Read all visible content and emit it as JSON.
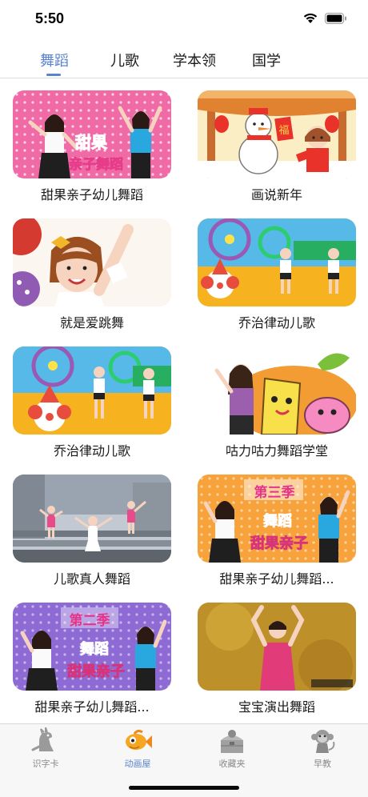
{
  "status_bar": {
    "time": "5:50",
    "icons": [
      "wifi-icon",
      "battery-icon"
    ]
  },
  "top_tabs": {
    "active_index": 0,
    "accent_color": "#5b84ce",
    "items": [
      {
        "label": "舞蹈"
      },
      {
        "label": "儿歌"
      },
      {
        "label": "学本领"
      },
      {
        "label": "国学"
      }
    ]
  },
  "videos": [
    {
      "title": "甜果亲子幼儿舞蹈"
    },
    {
      "title": "画说新年"
    },
    {
      "title": "就是爱跳舞"
    },
    {
      "title": "乔治律动儿歌"
    },
    {
      "title": "乔治律动儿歌"
    },
    {
      "title": "咕力咕力舞蹈学堂"
    },
    {
      "title": "儿歌真人舞蹈"
    },
    {
      "title": "甜果亲子幼儿舞蹈..."
    },
    {
      "title": "甜果亲子幼儿舞蹈..."
    },
    {
      "title": "宝宝演出舞蹈"
    }
  ],
  "thumbnail_text": {
    "v1_line1": "甜果",
    "v1_line2": "亲子舞蹈",
    "v2_sign": "福",
    "v8_season": "第三季",
    "v8_line1": "舞蹈",
    "v8_line2": "甜果亲子",
    "v9_season": "第二季",
    "v9_line1": "舞蹈",
    "v9_line2": "甜果亲子"
  },
  "bottom_tabs": {
    "active_index": 1,
    "items": [
      {
        "label": "识字卡",
        "icon": "dinosaur-icon"
      },
      {
        "label": "动画屋",
        "icon": "goldfish-icon"
      },
      {
        "label": "收藏夹",
        "icon": "treasure-chest-icon"
      },
      {
        "label": "早教",
        "icon": "monkey-icon"
      }
    ]
  }
}
